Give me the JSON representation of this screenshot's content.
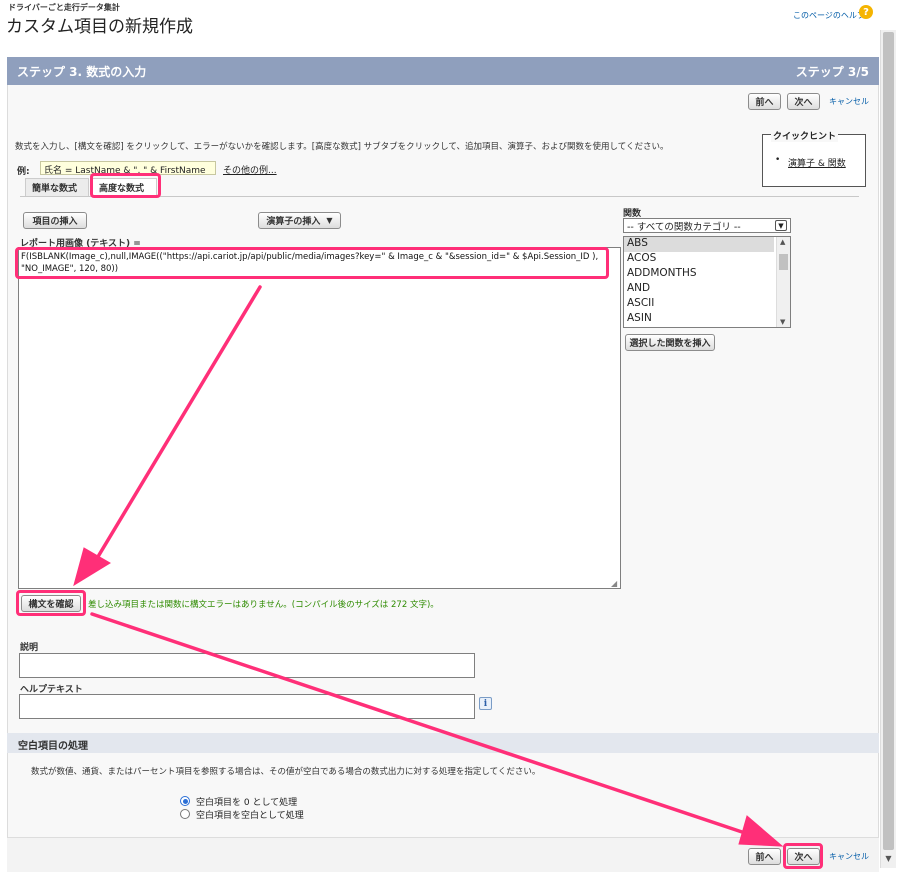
{
  "page": {
    "object_label": "ドライバーごと走行データ集計",
    "title": "カスタム項目の新規作成",
    "help_link": "このページのヘルプ"
  },
  "step": {
    "title": "ステップ 3. 数式の入力",
    "counter": "ステップ 3/5"
  },
  "nav": {
    "prev": "前へ",
    "next": "次へ",
    "cancel": "キャンセル"
  },
  "intro": "数式を入力し、[構文を確認] をクリックして、エラーがないかを確認します。[高度な数式] サブタブをクリックして、追加項目、演算子、および関数を使用してください。",
  "example": {
    "label": "例:",
    "value": "氏名 = LastName & \", \" & FirstName",
    "more_link": "その他の例..."
  },
  "quick_tips": {
    "title": "クイックヒント",
    "link": "演算子 & 関数"
  },
  "tabs": [
    {
      "label": "簡単な数式"
    },
    {
      "label": "高度な数式"
    }
  ],
  "buttons": {
    "insert_field": "項目の挿入",
    "insert_operator": "演算子の挿入",
    "insert_function": "選択した関数を挿入",
    "check_syntax": "構文を確認"
  },
  "formula": {
    "label": "レポート用画像 (テキスト) =",
    "value": "F(ISBLANK(Image_c),null,IMAGE((\"https://api.cariot.jp/api/public/media/images?key=\" & Image_c & \"&session_id=\" & $Api.Session_ID ), \"NO_IMAGE\", 120, 80))"
  },
  "syntax_message": "差し込み項目または関数に構文エラーはありません。(コンパイル後のサイズは 272 文字)。",
  "functions": {
    "label": "関数",
    "category": "-- すべての関数カテゴリ --",
    "items": [
      "ABS",
      "ACOS",
      "ADDMONTHS",
      "AND",
      "ASCII",
      "ASIN"
    ]
  },
  "description": {
    "label": "説明",
    "value": ""
  },
  "help_text": {
    "label": "ヘルプテキスト",
    "value": ""
  },
  "blank": {
    "title": "空白項目の処理",
    "text": "数式が数値、通貨、またはパーセント項目を参照する場合は、その値が空白である場合の数式出力に対する処理を指定してください。",
    "opt_zero": "空白項目を 0 として処理",
    "opt_blank": "空白項目を空白として処理"
  },
  "colors": {
    "header": "#8f9fbd",
    "highlight": "#ff2f78",
    "success": "#2e8b00",
    "link": "#015ba7"
  }
}
